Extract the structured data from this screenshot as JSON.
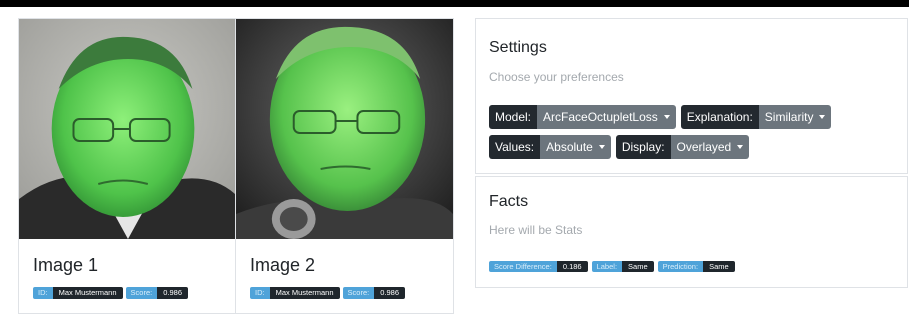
{
  "images": [
    {
      "title": "Image 1",
      "id_label": "ID:",
      "id_value": "Max Mustermann",
      "score_label": "Score:",
      "score_value": "0.986"
    },
    {
      "title": "Image 2",
      "id_label": "ID:",
      "id_value": "Max Mustermann",
      "score_label": "Score:",
      "score_value": "0.986"
    }
  ],
  "settings": {
    "title": "Settings",
    "subtitle": "Choose your preferences",
    "model_label": "Model:",
    "model_value": "ArcFaceOctupletLoss",
    "explanation_label": "Explanation:",
    "explanation_value": "Similarity",
    "values_label": "Values:",
    "values_value": "Absolute",
    "display_label": "Display:",
    "display_value": "Overlayed"
  },
  "facts": {
    "title": "Facts",
    "subtitle": "Here will be Stats",
    "score_diff_label": "Score Difference:",
    "score_diff_value": "0.186",
    "label_label": "Label:",
    "label_value": "Same",
    "prediction_label": "Prediction:",
    "prediction_value": "Same"
  },
  "colors": {
    "overlay_green": "#5fd35c",
    "badge_key": "#4fa3d9",
    "badge_value": "#1f262c",
    "select_bg": "#6c757d",
    "label_bg": "#23292f"
  },
  "icons": [
    "caret-down-icon"
  ]
}
